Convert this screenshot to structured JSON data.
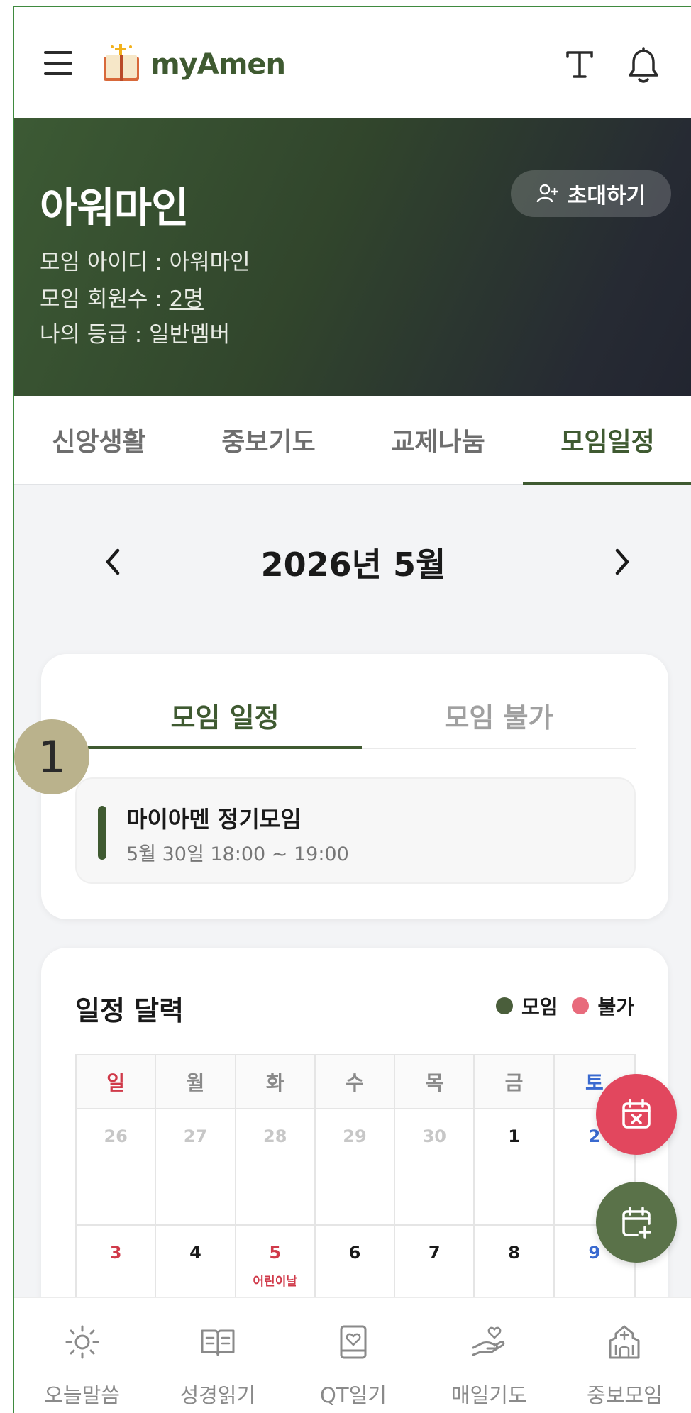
{
  "app": {
    "logo_text": "myAmen"
  },
  "header": {
    "title": "아워마인",
    "info": [
      {
        "label": "모임 아이디 : ",
        "value": "아워마인"
      },
      {
        "label": "모임 회원수 : ",
        "value": "2명"
      },
      {
        "label": "나의 등급 : ",
        "value": "일반멤버"
      }
    ],
    "invite_label": "초대하기"
  },
  "tabs": [
    {
      "label": "신앙생활",
      "active": false
    },
    {
      "label": "중보기도",
      "active": false
    },
    {
      "label": "교제나눔",
      "active": false
    },
    {
      "label": "모임일정",
      "active": true
    }
  ],
  "month_nav": {
    "title": "2026년 5월"
  },
  "schedule_card": {
    "subtabs": [
      {
        "label": "모임 일정",
        "active": true
      },
      {
        "label": "모임 불가",
        "active": false
      }
    ],
    "events": [
      {
        "title": "마이아멘 정기모임",
        "time": "5월 30일 18:00 ~ 19:00"
      }
    ]
  },
  "badge": {
    "number": "1"
  },
  "calendar": {
    "title": "일정 달력",
    "legend": [
      {
        "label": "모임",
        "color": "#4a5e3b"
      },
      {
        "label": "불가",
        "color": "#e86b7c"
      }
    ],
    "weekdays": [
      "일",
      "월",
      "화",
      "수",
      "목",
      "금",
      "토"
    ],
    "weeks": [
      [
        {
          "day": "26",
          "other": true
        },
        {
          "day": "27",
          "other": true
        },
        {
          "day": "28",
          "other": true
        },
        {
          "day": "29",
          "other": true
        },
        {
          "day": "30",
          "other": true
        },
        {
          "day": "1"
        },
        {
          "day": "2"
        }
      ],
      [
        {
          "day": "3"
        },
        {
          "day": "4"
        },
        {
          "day": "5",
          "holiday": "어린이날"
        },
        {
          "day": "6"
        },
        {
          "day": "7"
        },
        {
          "day": "8"
        },
        {
          "day": "9"
        }
      ]
    ]
  },
  "bottom_nav": [
    {
      "label": "오늘말씀",
      "icon": "sun-icon"
    },
    {
      "label": "성경읽기",
      "icon": "open-book-icon"
    },
    {
      "label": "QT일기",
      "icon": "diary-heart-icon"
    },
    {
      "label": "매일기도",
      "icon": "praying-hand-icon"
    },
    {
      "label": "중보모임",
      "icon": "church-icon"
    }
  ],
  "colors": {
    "brand": "#3f5a31",
    "danger": "#e2475e",
    "fab_green": "#5a7249"
  }
}
